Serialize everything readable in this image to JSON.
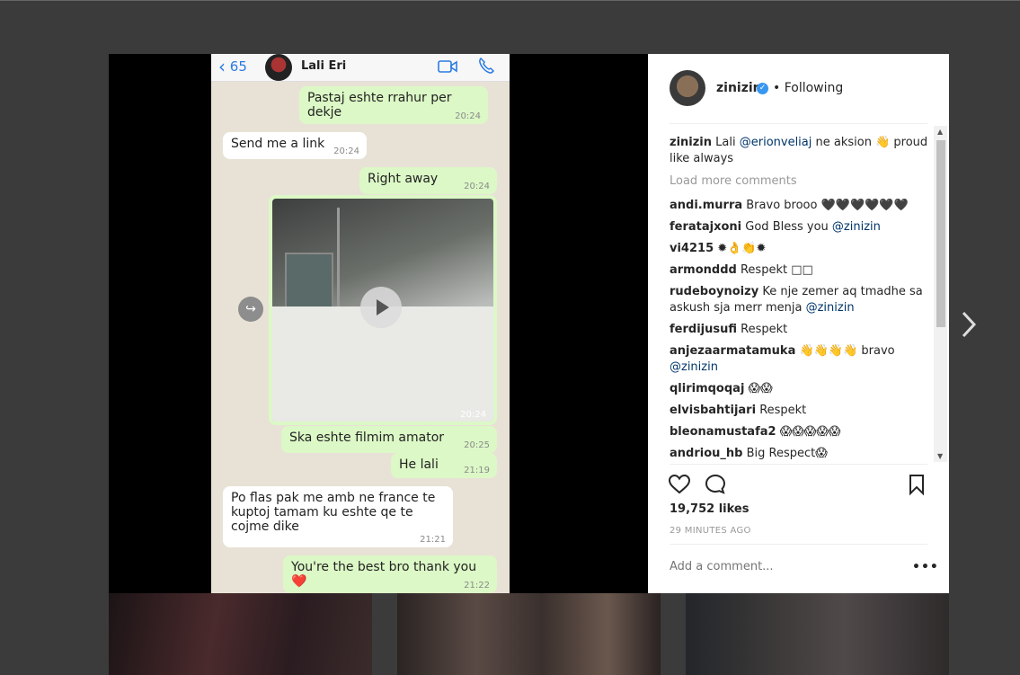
{
  "phone": {
    "back_count": "65",
    "contact_name": "Lali Eri",
    "messages": [
      {
        "text": "Pastaj eshte rrahur per dekje",
        "time": "20:24"
      },
      {
        "text": "Send me a link",
        "time": "20:24"
      },
      {
        "text": "Right away",
        "time": "20:24"
      },
      {
        "video_time": "20:24"
      },
      {
        "text": "Ska eshte filmim amator",
        "time": "20:25"
      },
      {
        "text": "He lali",
        "time": "21:19"
      },
      {
        "text": "Po flas pak me amb ne france te kuptoj tamam ku eshte qe te cojme dike",
        "time": "21:21"
      },
      {
        "text": "You're the best bro thank you ❤️",
        "time": "21:22"
      }
    ]
  },
  "post": {
    "username": "zinizin",
    "following": "• Following",
    "caption": {
      "user": "zinizin",
      "pre": "Lali ",
      "mention": "@erionveliaj",
      "post": " ne aksion 👋 proud like always"
    },
    "load_more": "Load more comments",
    "comments": [
      {
        "user": "andi.murra",
        "text": "Bravo brooo 🖤🖤🖤🖤🖤🖤"
      },
      {
        "user": "feratajxoni",
        "text": "God Bless you ",
        "mention": "@zinizin"
      },
      {
        "user": "vi4215",
        "text": "✹👌👏✹"
      },
      {
        "user": "armonddd",
        "text": "Respekt □□"
      },
      {
        "user": "rudeboynoizy",
        "text": "Ke nje zemer aq tmadhe sa askush sja merr menja ",
        "mention": "@zinizin"
      },
      {
        "user": "ferdijusufi",
        "text": "Respekt"
      },
      {
        "user": "anjezaarmatamuka",
        "text": "👋👋👋👋 bravo ",
        "mention": "@zinizin"
      },
      {
        "user": "qlirimqoqaj",
        "text": "😱😱"
      },
      {
        "user": "elvisbahtijari",
        "text": "Respekt"
      },
      {
        "user": "bleonamustafa2",
        "text": "😱😱😱😱😱"
      },
      {
        "user": "andriou_hb",
        "text": "Big Respect😱"
      }
    ],
    "likes": "19,752 likes",
    "time_ago": "29 MINUTES AGO",
    "add_comment_placeholder": "Add a comment...",
    "more_label": "•••"
  }
}
